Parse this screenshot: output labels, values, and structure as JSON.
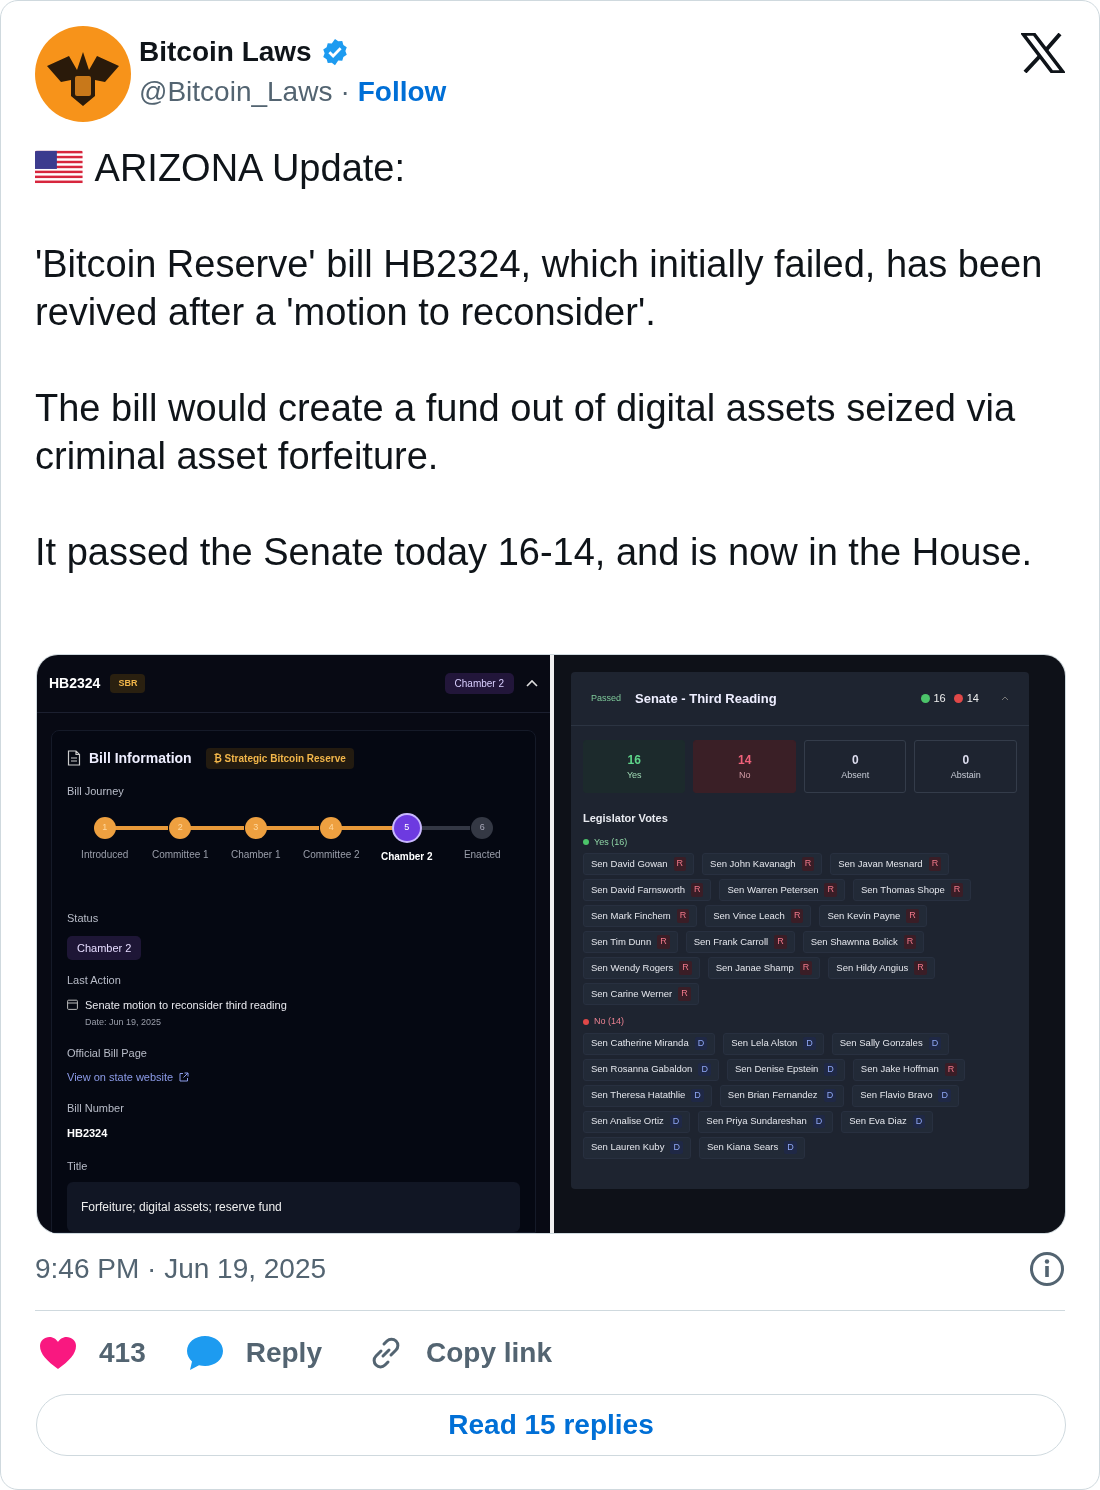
{
  "author": {
    "name": "Bitcoin Laws",
    "verified": true,
    "handle": "@Bitcoin_Laws",
    "separator": "·",
    "follow": "Follow"
  },
  "paragraphs": [
    {
      "text": "ARIZONA Update:",
      "flag": true
    },
    {
      "text": "'Bitcoin Reserve' bill HB2324, which initially failed, has been revived after a 'motion to reconsider'.",
      "flag": false
    },
    {
      "text": "The bill would create a fund out of digital assets seized via criminal asset forfeiture.",
      "flag": false
    },
    {
      "text": "It passed the Senate today 16-14, and is now in the House.",
      "flag": false
    }
  ],
  "bill_panel": {
    "bill": "HB2324",
    "tag": "SBR",
    "chamber_badge": "Chamber 2",
    "section_title": "Bill Information",
    "topic_tag": "₿ Strategic Bitcoin Reserve",
    "journey_label": "Bill Journey",
    "journey": [
      {
        "number": "1",
        "label": "Introduced",
        "completed": true,
        "selected": false
      },
      {
        "number": "2",
        "label": "Committee 1",
        "completed": true,
        "selected": false
      },
      {
        "number": "3",
        "label": "Chamber 1",
        "completed": true,
        "selected": false
      },
      {
        "number": "4",
        "label": "Committee 2",
        "completed": true,
        "selected": false
      },
      {
        "number": "5",
        "label": "Chamber 2",
        "completed": false,
        "selected": true
      },
      {
        "number": "6",
        "label": "Enacted",
        "completed": false,
        "selected": false
      }
    ],
    "status_label": "Status",
    "status": "Chamber 2",
    "last_action_label": "Last Action",
    "last_action": "Senate motion to reconsider third reading",
    "last_action_date": "Date: Jun 19, 2025",
    "official_label": "Official Bill Page",
    "official_link": "View on state website",
    "number_label": "Bill Number",
    "number": "HB2324",
    "title_label": "Title",
    "title": "Forfeiture; digital assets; reserve fund"
  },
  "vote_panel": {
    "result": "Passed",
    "title": "Senate - Third Reading",
    "yes_count": "16",
    "no_count": "14",
    "tallies": [
      {
        "value": "16",
        "label": "Yes",
        "kind": "yes"
      },
      {
        "value": "14",
        "label": "No",
        "kind": "no"
      },
      {
        "value": "0",
        "label": "Absent",
        "kind": "neutral"
      },
      {
        "value": "0",
        "label": "Abstain",
        "kind": "neutral"
      }
    ],
    "votes_title": "Legislator Votes",
    "groups": [
      {
        "label": "Yes (16)",
        "kind": "yes",
        "members": [
          {
            "name": "Sen David Gowan",
            "party": "R",
            "kind": "republican"
          },
          {
            "name": "Sen John Kavanagh",
            "party": "R",
            "kind": "republican"
          },
          {
            "name": "Sen Javan Mesnard",
            "party": "R",
            "kind": "republican"
          },
          {
            "name": "Sen David Farnsworth",
            "party": "R",
            "kind": "republican"
          },
          {
            "name": "Sen Warren Petersen",
            "party": "R",
            "kind": "republican"
          },
          {
            "name": "Sen Thomas Shope",
            "party": "R",
            "kind": "republican"
          },
          {
            "name": "Sen Mark Finchem",
            "party": "R",
            "kind": "republican"
          },
          {
            "name": "Sen Vince Leach",
            "party": "R",
            "kind": "republican"
          },
          {
            "name": "Sen Kevin Payne",
            "party": "R",
            "kind": "republican"
          },
          {
            "name": "Sen Tim Dunn",
            "party": "R",
            "kind": "republican"
          },
          {
            "name": "Sen Frank Carroll",
            "party": "R",
            "kind": "republican"
          },
          {
            "name": "Sen Shawnna Bolick",
            "party": "R",
            "kind": "republican"
          },
          {
            "name": "Sen Wendy Rogers",
            "party": "R",
            "kind": "republican"
          },
          {
            "name": "Sen Janae Shamp",
            "party": "R",
            "kind": "republican"
          },
          {
            "name": "Sen Hildy Angius",
            "party": "R",
            "kind": "republican"
          },
          {
            "name": "Sen Carine Werner",
            "party": "R",
            "kind": "republican"
          }
        ]
      },
      {
        "label": "No (14)",
        "kind": "no",
        "members": [
          {
            "name": "Sen Catherine Miranda",
            "party": "D",
            "kind": "democrat"
          },
          {
            "name": "Sen Lela Alston",
            "party": "D",
            "kind": "democrat"
          },
          {
            "name": "Sen Sally Gonzales",
            "party": "D",
            "kind": "democrat"
          },
          {
            "name": "Sen Rosanna Gabaldon",
            "party": "D",
            "kind": "democrat"
          },
          {
            "name": "Sen Denise Epstein",
            "party": "D",
            "kind": "democrat"
          },
          {
            "name": "Sen Jake Hoffman",
            "party": "R",
            "kind": "republican"
          },
          {
            "name": "Sen Theresa Hatathlie",
            "party": "D",
            "kind": "democrat"
          },
          {
            "name": "Sen Brian Fernandez",
            "party": "D",
            "kind": "democrat"
          },
          {
            "name": "Sen Flavio Bravo",
            "party": "D",
            "kind": "democrat"
          },
          {
            "name": "Sen Analise Ortiz",
            "party": "D",
            "kind": "democrat"
          },
          {
            "name": "Sen Priya Sundareshan",
            "party": "D",
            "kind": "democrat"
          },
          {
            "name": "Sen Eva Diaz",
            "party": "D",
            "kind": "democrat"
          },
          {
            "name": "Sen Lauren Kuby",
            "party": "D",
            "kind": "democrat"
          },
          {
            "name": "Sen Kiana Sears",
            "party": "D",
            "kind": "democrat"
          }
        ]
      }
    ]
  },
  "timestamp": "9:46 PM · Jun 19, 2025",
  "actions": {
    "likes": "413",
    "reply": "Reply",
    "copy_link": "Copy link"
  },
  "read_replies": "Read 15 replies"
}
